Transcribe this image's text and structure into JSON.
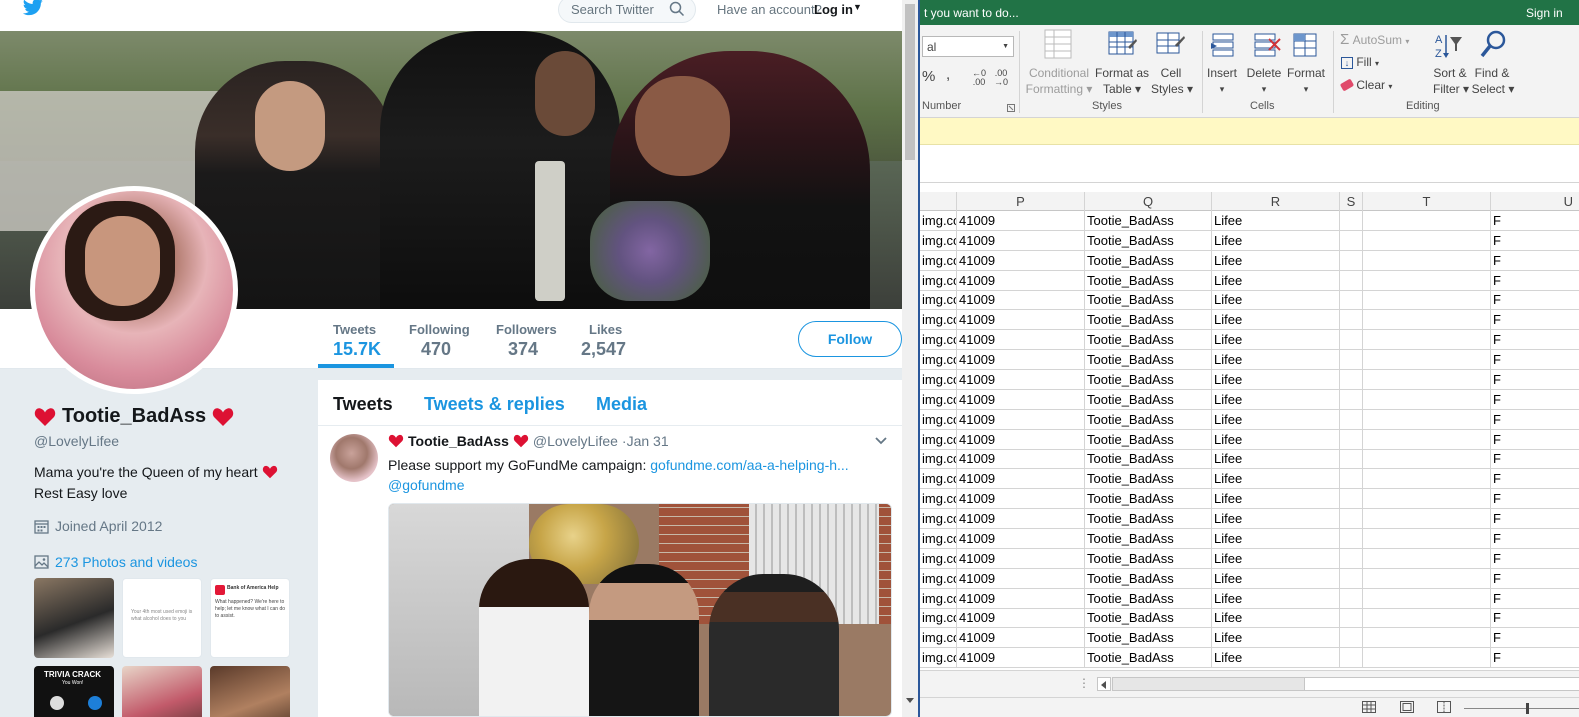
{
  "twitter": {
    "search_placeholder": "Search Twitter",
    "have_account": "Have an account?",
    "login": "Log in",
    "stats": [
      {
        "label": "Tweets",
        "value": "15.7K"
      },
      {
        "label": "Following",
        "value": "470"
      },
      {
        "label": "Followers",
        "value": "374"
      },
      {
        "label": "Likes",
        "value": "2,547"
      }
    ],
    "follow_label": "Follow",
    "display_name": "Tootie_BadAss",
    "handle": "@LovelyLifee",
    "bio_line1": "Mama you're the Queen of my heart",
    "bio_line2": "Rest Easy love",
    "joined": "Joined April 2012",
    "photos_link": "273 Photos and videos",
    "thumb_text": "Your 4th most used emoji is what alcohol does to you",
    "thumb_boa_title": "Bank of America Help",
    "thumb_boa_text": "What happened? We're here to help; let me know what I can do to assist.",
    "trivia_title": "TRIVIA CRACK",
    "trivia_sub": "You Won!",
    "tabs": [
      "Tweets",
      "Tweets & replies",
      "Media"
    ],
    "tweet": {
      "name": "Tootie_BadAss",
      "handle": "@LovelyLifee",
      "date": "·Jan 31",
      "text": "Please support my GoFundMe campaign:",
      "link": "gofundme.com/aa-a-helping-h...",
      "mention": "@gofundme"
    },
    "colors": {
      "blue": "#1b95e0",
      "heart": "#e0245e"
    }
  },
  "excel": {
    "tell_me": "t you want to do...",
    "sign_in": "Sign in",
    "font_box": "al",
    "number_group": "Number",
    "percent": "%",
    "comma": ",",
    "inc_dec": ".0 .00",
    "dec_dec": ".00 →.0",
    "cond_format_1": "Conditional",
    "cond_format_2": "Formatting",
    "format_table_1": "Format as",
    "format_table_2": "Table",
    "cell_styles_1": "Cell",
    "cell_styles_2": "Styles",
    "styles_group": "Styles",
    "insert": "Insert",
    "delete": "Delete",
    "format": "Format",
    "cells_group": "Cells",
    "autosum": "AutoSum",
    "fill": "Fill",
    "clear": "Clear",
    "sort_1": "Sort &",
    "sort_2": "Filter",
    "find_1": "Find &",
    "find_2": "Select",
    "editing_group": "Editing",
    "columns": [
      "P",
      "Q",
      "R",
      "S",
      "T",
      "U"
    ],
    "row_values": [
      "img.co",
      "41009",
      "Tootie_BadAss",
      "Lifee",
      "",
      "",
      "F"
    ],
    "row_count": 23,
    "hscroll_dots": "⋮",
    "accent": "#217346"
  }
}
